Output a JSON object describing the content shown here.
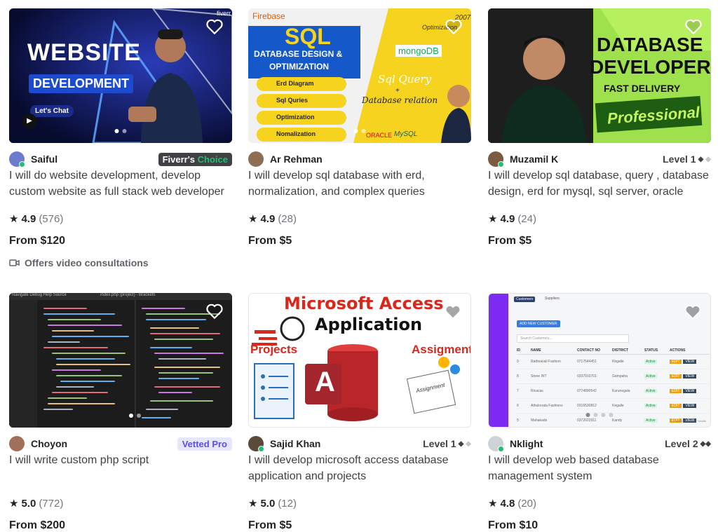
{
  "gigs": [
    {
      "seller": "Saiful",
      "badge_type": "fiverr-choice",
      "badge_part1": "Fiverr's",
      "badge_part2": "Choice",
      "title": "I will do website development, develop custom website as full stack web developer",
      "rating": "4.9",
      "reviews": "(576)",
      "price": "From $120",
      "extra": "Offers video consultations",
      "thumb": {
        "line1": "WEBSITE",
        "line2": "DEVELOPMENT",
        "cta": "Let's Chat",
        "corner": "fiverr"
      }
    },
    {
      "seller": "Ar Rehman",
      "badge_type": "none",
      "title": "I will develop sql database with erd, normalization, and complex queries",
      "rating": "4.9",
      "reviews": "(28)",
      "price": "From $5",
      "thumb": {
        "brand": "Firebase",
        "head": "SQL",
        "sub1": "DATABASE DESIGN &",
        "sub2": "OPTIMIZATION",
        "pills": [
          "Erd Diagram",
          "Sql Quries",
          "Optimization",
          "Nomalization"
        ],
        "mongo": "mongoDB",
        "q1": "Sql Query",
        "q2": "+",
        "q3": "Database relation",
        "oracle": "ORACLE",
        "mysql": "MySQL",
        "opt": "Optimization",
        "year": "2007"
      }
    },
    {
      "seller": "Muzamil K",
      "badge_type": "level",
      "level": "Level 1",
      "diamonds_on": "◆",
      "diamonds_off": "◆",
      "title": "I will develop sql database, query , database design, erd for mysql, sql server, oracle",
      "rating": "4.9",
      "reviews": "(24)",
      "price": "From $5",
      "thumb": {
        "l1": "DATABASE",
        "l2": "DEVELOPER",
        "l3": "FAST DELIVERY",
        "l4": "Professional"
      }
    },
    {
      "seller": "Choyon",
      "badge_type": "vetted",
      "badge": "Vetted Pro",
      "title": "I will write custom php script",
      "rating": "5.0",
      "reviews": "(772)",
      "price": "From $200",
      "thumb": {
        "menu": "Navigate  Debug  Help  Source",
        "tab": "index.php (project) - Brackets"
      }
    },
    {
      "seller": "Sajid Khan",
      "badge_type": "level",
      "level": "Level 1",
      "diamonds_on": "◆",
      "diamonds_off": "◆",
      "title": "I will develop microsoft access database application and projects",
      "rating": "5.0",
      "reviews": "(12)",
      "price": "From $5",
      "thumb": {
        "l1": "Microsoft Access",
        "l2": "Application",
        "left": "Projects",
        "right": "Assigment",
        "letter": "A",
        "tag": "Assignment"
      }
    },
    {
      "seller": "Nklight",
      "badge_type": "level",
      "level": "Level 2",
      "diamonds_on": "◆◆",
      "diamonds_off": "",
      "title": "I will develop web based database management system",
      "rating": "4.8",
      "reviews": "(20)",
      "price": "From $10",
      "thumb": {
        "tab1": "Customers",
        "tab2": "Suppliers",
        "add": "ADD NEW CUSTOMER",
        "search": "Search Customers...",
        "cols": [
          "ID",
          "NAME",
          "CONTACT NO",
          "DISTRICT",
          "STATUS",
          "ACTIONS"
        ],
        "rows": [
          [
            "9",
            "Rathnavali Fashion",
            "0717544451",
            "Kegalle"
          ],
          [
            "8",
            "Stone INT",
            "0337910701",
            "Gampaha"
          ],
          [
            "7",
            "Ricacas",
            "0774890542",
            "Kurunegala"
          ],
          [
            "6",
            "Athukorala Fashions",
            "0316530812",
            "Kegalle"
          ],
          [
            "5",
            "Mahakade",
            "0372022911",
            "Kandy"
          ]
        ],
        "status": "Active",
        "edit": "EDIT",
        "view": "VIEW",
        "footer": "Showing 1 to 8 of 7 results"
      }
    }
  ],
  "colors": {
    "green": "#1dbf73",
    "text": "#404145",
    "dark": "#222325",
    "muted": "#74767e"
  },
  "icons": {
    "heart": "heart-icon",
    "star": "star-icon",
    "video": "video-camera-icon"
  }
}
